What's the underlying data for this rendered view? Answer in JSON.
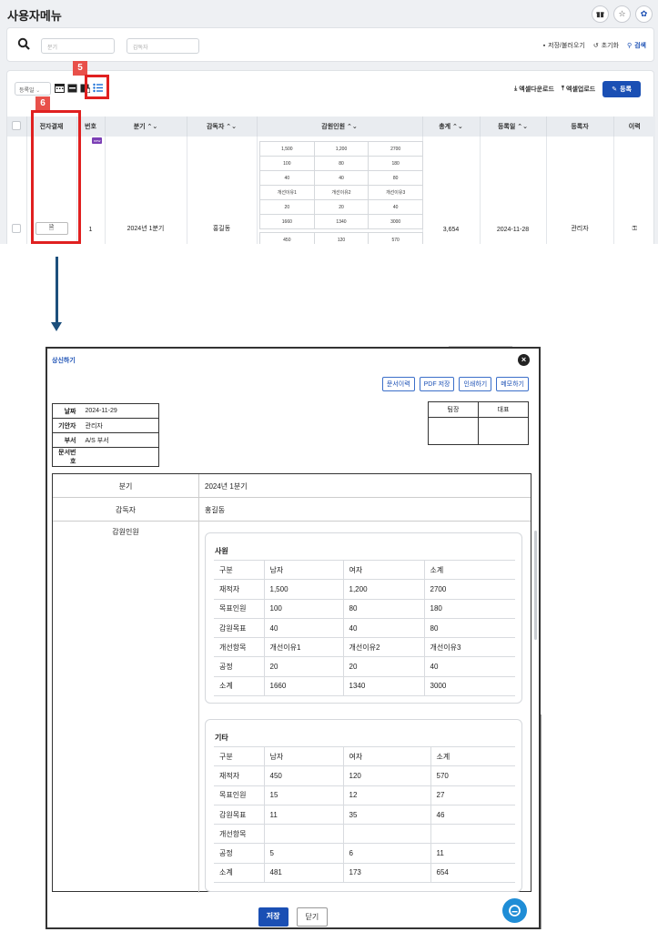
{
  "top": {
    "page_title": "사용자메뉴",
    "header_icons": [
      "gift-icon",
      "star-icon",
      "gear-icon"
    ],
    "search": {
      "quarter_placeholder": "분기",
      "supervisor_placeholder": "감독자",
      "save_load_label": "저장/불러오기",
      "reset_label": "초기화",
      "search_label": "검색"
    },
    "toolbar": {
      "sort_value": "등록일",
      "excel_download_label": "엑셀다운로드",
      "excel_upload_label": "엑셀업로드",
      "register_label": "등록"
    },
    "table": {
      "headers": [
        "전자결재",
        "번호",
        "분기",
        "감독자",
        "감원인원",
        "총계",
        "등록일",
        "등록자",
        "이력"
      ],
      "row": {
        "number": "1",
        "quarter": "2024년 1분기",
        "supervisor": "홍길동",
        "total": "3,654",
        "reg_date": "2024-11-28",
        "registrant": "관리자",
        "new_badge": "new"
      },
      "mini_rows": [
        [
          "1,500",
          "1,200",
          "2700"
        ],
        [
          "100",
          "80",
          "180"
        ],
        [
          "40",
          "40",
          "80"
        ],
        [
          "개선이유1",
          "개선이유2",
          "개선이유3"
        ],
        [
          "20",
          "20",
          "40"
        ],
        [
          "1660",
          "1340",
          "3000"
        ]
      ],
      "mini_rows2": [
        [
          "450",
          "120",
          "570"
        ]
      ]
    },
    "annotations": [
      "5",
      "6"
    ]
  },
  "modal": {
    "title": "상신하기",
    "actions": [
      "문서이력",
      "PDF 저장",
      "인쇄하기",
      "메모하기"
    ],
    "info": [
      {
        "label": "날짜",
        "value": "2024-11-29"
      },
      {
        "label": "기안자",
        "value": "관리자"
      },
      {
        "label": "부서",
        "value": "A/S 부서"
      },
      {
        "label": "문서번호",
        "value": ""
      }
    ],
    "approval": [
      "팀장",
      "대표"
    ],
    "fields": {
      "quarter_label": "분기",
      "quarter_value": "2024년 1분기",
      "supervisor_label": "감독자",
      "supervisor_value": "홍길동",
      "reduction_label": "감원인원"
    },
    "staff": {
      "title": "사원",
      "header": [
        "구분",
        "남자",
        "여자",
        "소계"
      ],
      "rows": [
        [
          "재적자",
          "1,500",
          "1,200",
          "2700"
        ],
        [
          "목표인원",
          "100",
          "80",
          "180"
        ],
        [
          "감원목표",
          "40",
          "40",
          "80"
        ],
        [
          "개선항목",
          "개선이유1",
          "개선이유2",
          "개선이유3"
        ],
        [
          "공정",
          "20",
          "20",
          "40"
        ],
        [
          "소계",
          "1660",
          "1340",
          "3000"
        ]
      ]
    },
    "other": {
      "title": "기타",
      "header": [
        "구분",
        "남자",
        "여자",
        "소계"
      ],
      "rows": [
        [
          "재적자",
          "450",
          "120",
          "570"
        ],
        [
          "목표인원",
          "15",
          "12",
          "27"
        ],
        [
          "감원목표",
          "11",
          "35",
          "46"
        ],
        [
          "개선항목",
          "",
          "",
          ""
        ],
        [
          "공정",
          "5",
          "6",
          "11"
        ],
        [
          "소계",
          "481",
          "173",
          "654"
        ]
      ]
    },
    "save_label": "저장",
    "close_label": "닫기"
  }
}
